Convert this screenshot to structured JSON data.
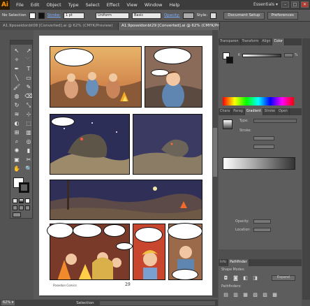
{
  "app": {
    "logo": "Ai",
    "workspace": "Essentials ▾"
  },
  "menu": [
    "File",
    "Edit",
    "Object",
    "Type",
    "Select",
    "Effect",
    "View",
    "Window",
    "Help"
  ],
  "window_controls": [
    "–",
    "□",
    "✕"
  ],
  "control": {
    "selection": "No Selection",
    "stroke_label": "Stroke:",
    "stroke_weight": "1 pt",
    "profile": "Uniform",
    "brush": "Basic",
    "opacity_label": "Opacity:",
    "style_label": "Style:",
    "document_setup": "Document Setup",
    "preferences": "Preferences"
  },
  "tabs": [
    {
      "label": "A1.9poseidonbt08 [Converted].ai @ 62% (CMYK/Preview)",
      "active": false
    },
    {
      "label": "A1.9poseidonbt29 [Converted].ai @ 62% (CMYK/Preview)",
      "active": true
    }
  ],
  "tools": {
    "icons": [
      "selection-arrow",
      "direct-selection",
      "magic-wand",
      "lasso",
      "pen",
      "type",
      "line",
      "rectangle",
      "paintbrush",
      "pencil",
      "blob-brush",
      "eraser",
      "rotate",
      "scale",
      "width",
      "free-transform",
      "shape-builder",
      "perspective",
      "mesh",
      "gradient",
      "eyedropper",
      "blend",
      "symbol-sprayer",
      "column-graph",
      "artboard",
      "slice",
      "hand",
      "zoom"
    ],
    "glyphs": [
      "↖",
      "↗",
      "✧",
      "➰",
      "✒",
      "T",
      "╲",
      "▭",
      "🖌",
      "✎",
      "◍",
      "⌫",
      "↻",
      "⤡",
      "≋",
      "⊹",
      "◐",
      "⬚",
      "⊞",
      "▥",
      "⌕",
      "◎",
      "✺",
      "▮",
      "▣",
      "✂",
      "✋",
      "🔍"
    ]
  },
  "dock": {
    "top_tabs": [
      "Transparen",
      "Transform",
      "Align",
      "Color"
    ],
    "color_channel": "K",
    "color_value": "%",
    "mid_tabs": [
      "Chara",
      "Parag",
      "Gradient",
      "Stroke",
      "Open"
    ],
    "gradient": {
      "type_label": "Type:",
      "stroke_label": "Stroke:",
      "opacity_label": "Opacity:",
      "location_label": "Location:"
    },
    "bottom_tabs": [
      "Info",
      "Pathfinder"
    ],
    "pathfinder": {
      "shape_modes": "Shape Modes:",
      "pathfinders": "Pathfinders:",
      "expand": "Expand"
    }
  },
  "status": {
    "zoom": "62% ▾",
    "tool": "Selection"
  },
  "artboard": {
    "page_number": "29",
    "credit": "Poseidon Comics"
  },
  "colors": {
    "ui_bg": "#535353",
    "accent_logo": "#ff9a00",
    "panel_bg": "#5d5d5d"
  }
}
